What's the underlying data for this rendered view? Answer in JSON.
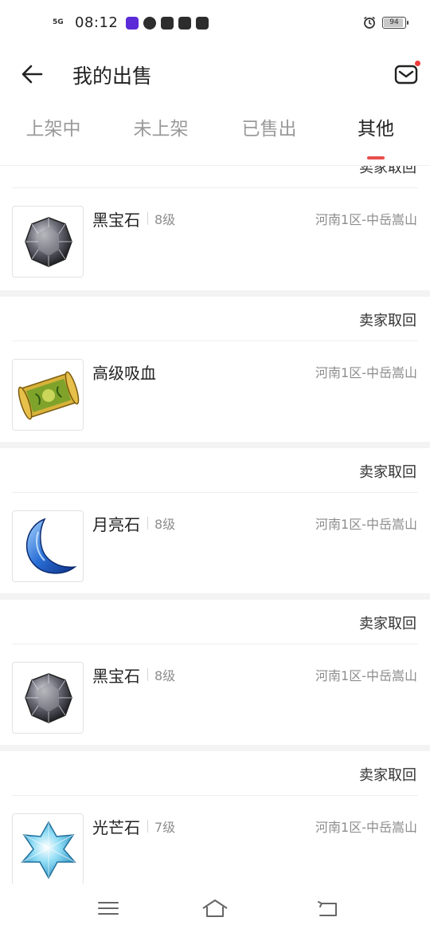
{
  "status_bar": {
    "network": "5G",
    "time": "08:12",
    "app_icons": [
      "video-app-icon",
      "compass-app-icon",
      "youku-app-icon",
      "at-app-icon",
      "mail-app-icon"
    ],
    "battery": "94",
    "battery_level": 0.94
  },
  "header": {
    "title": "我的出售"
  },
  "tabs": [
    {
      "label": "上架中",
      "active": false
    },
    {
      "label": "未上架",
      "active": false
    },
    {
      "label": "已售出",
      "active": false
    },
    {
      "label": "其他",
      "active": true
    }
  ],
  "partial_item": {
    "status": "卖家取回"
  },
  "items": [
    {
      "status": "卖家取回",
      "name": "黑宝石",
      "level": "8级",
      "server": "河南1区-中岳嵩山",
      "icon": "black-gem-icon"
    },
    {
      "status": "卖家取回",
      "name": "高级吸血",
      "level": "",
      "server": "河南1区-中岳嵩山",
      "icon": "scroll-icon"
    },
    {
      "status": "卖家取回",
      "name": "月亮石",
      "level": "8级",
      "server": "河南1区-中岳嵩山",
      "icon": "moonstone-icon"
    },
    {
      "status": "卖家取回",
      "name": "黑宝石",
      "level": "8级",
      "server": "河南1区-中岳嵩山",
      "icon": "black-gem-icon"
    },
    {
      "status": "卖家取回",
      "name": "光芒石",
      "level": "7级",
      "server": "河南1区-中岳嵩山",
      "icon": "radiant-stone-icon"
    }
  ],
  "colors": {
    "accent": "#e94e4e",
    "muted_text": "#8d8d8d",
    "divider": "#f3f3f3"
  }
}
